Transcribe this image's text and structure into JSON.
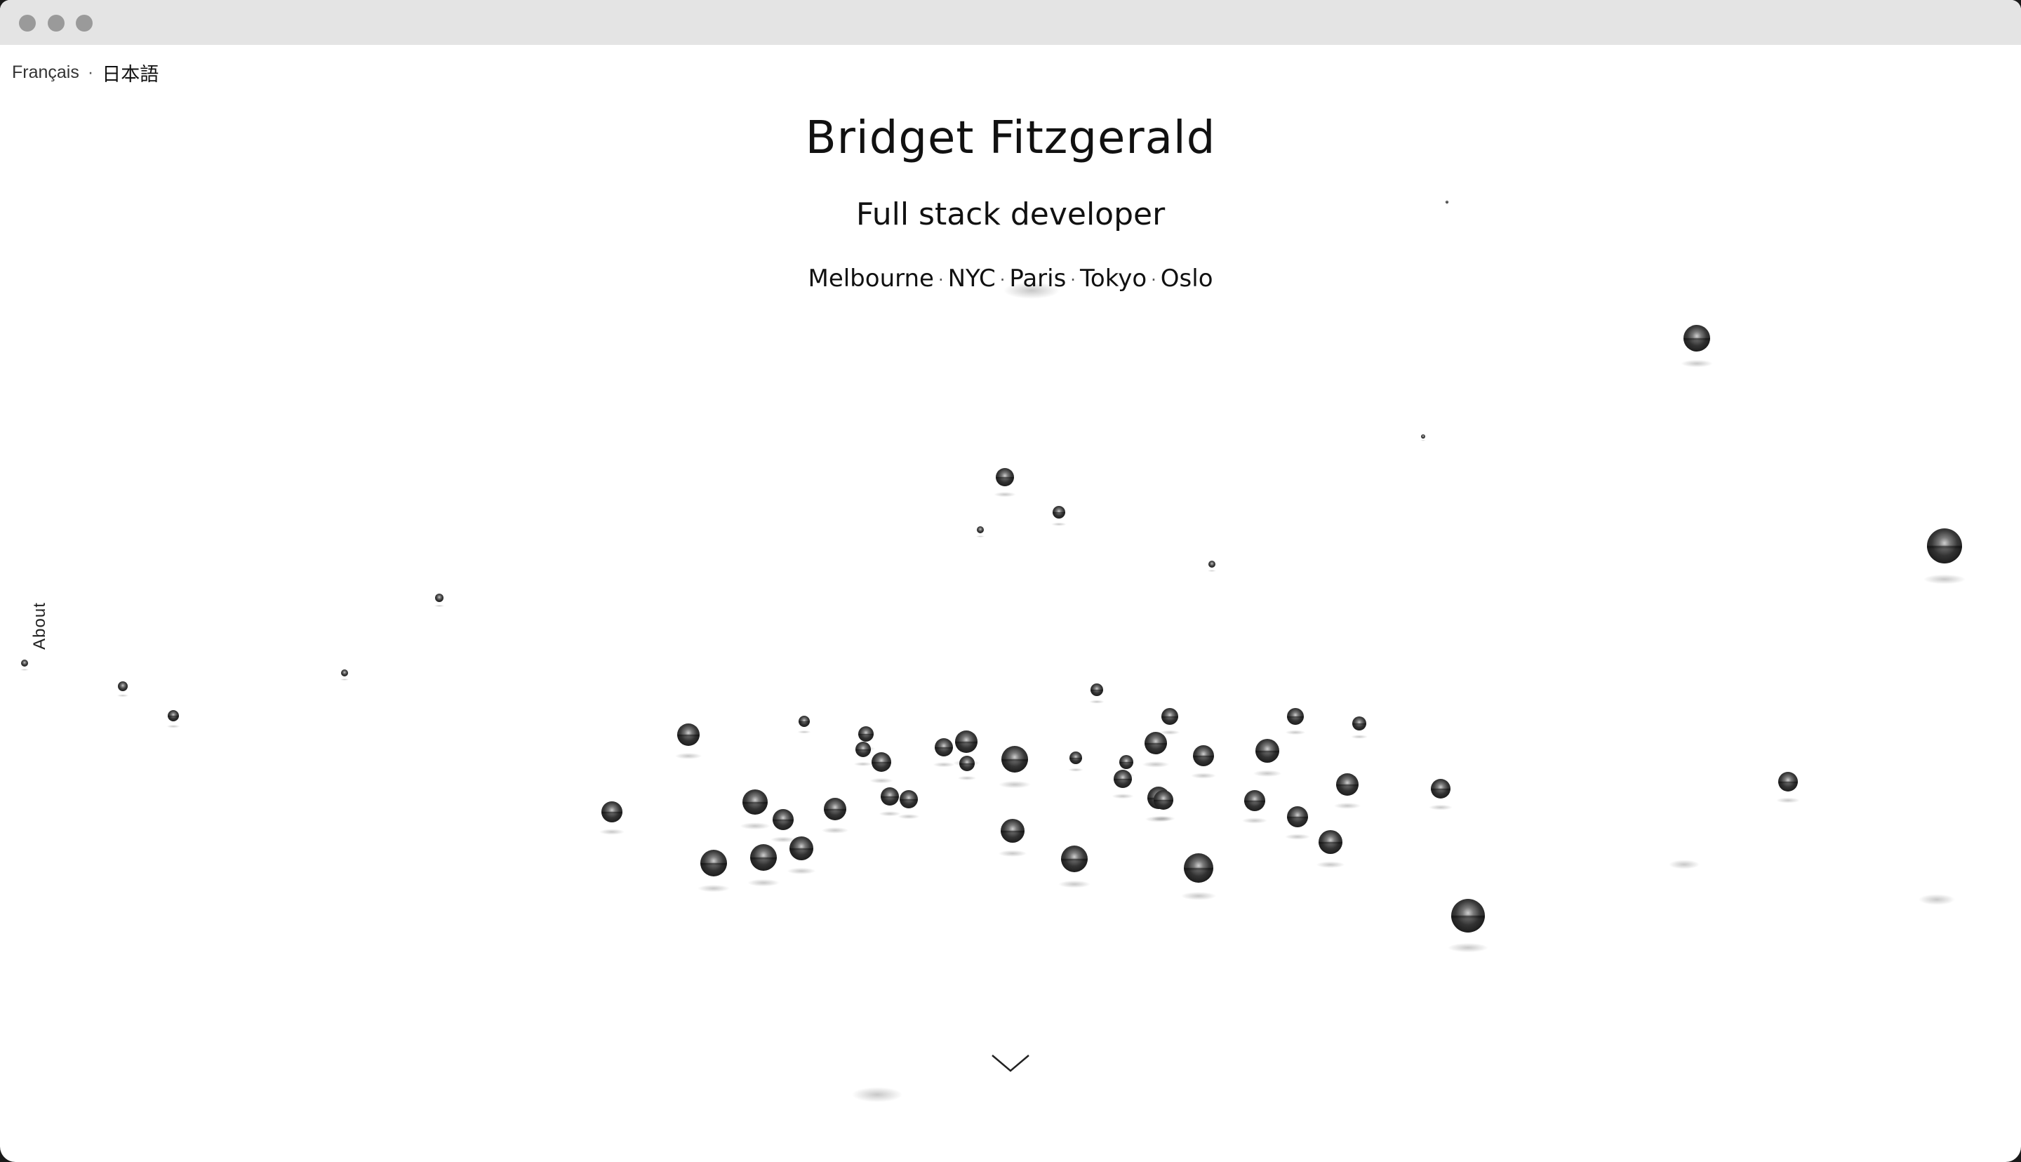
{
  "languages": {
    "french": "Français",
    "separator": "·",
    "japanese": "日本語"
  },
  "hero": {
    "name": "Bridget Fitzgerald",
    "role": "Full stack developer",
    "cities": [
      "Melbourne",
      "NYC",
      "Paris",
      "Tokyo",
      "Oslo"
    ],
    "city_separator": "·"
  },
  "side_nav": {
    "about_label": "About"
  },
  "icons": {
    "scroll_down": "chevron-down-icon",
    "window_controls": "traffic-light-dots"
  },
  "colors": {
    "background": "#ffffff",
    "titlebar": "#e4e4e4",
    "text": "#111111",
    "sphere_dark": "#2a2a2a",
    "sphere_light": "#d8d8d8"
  }
}
